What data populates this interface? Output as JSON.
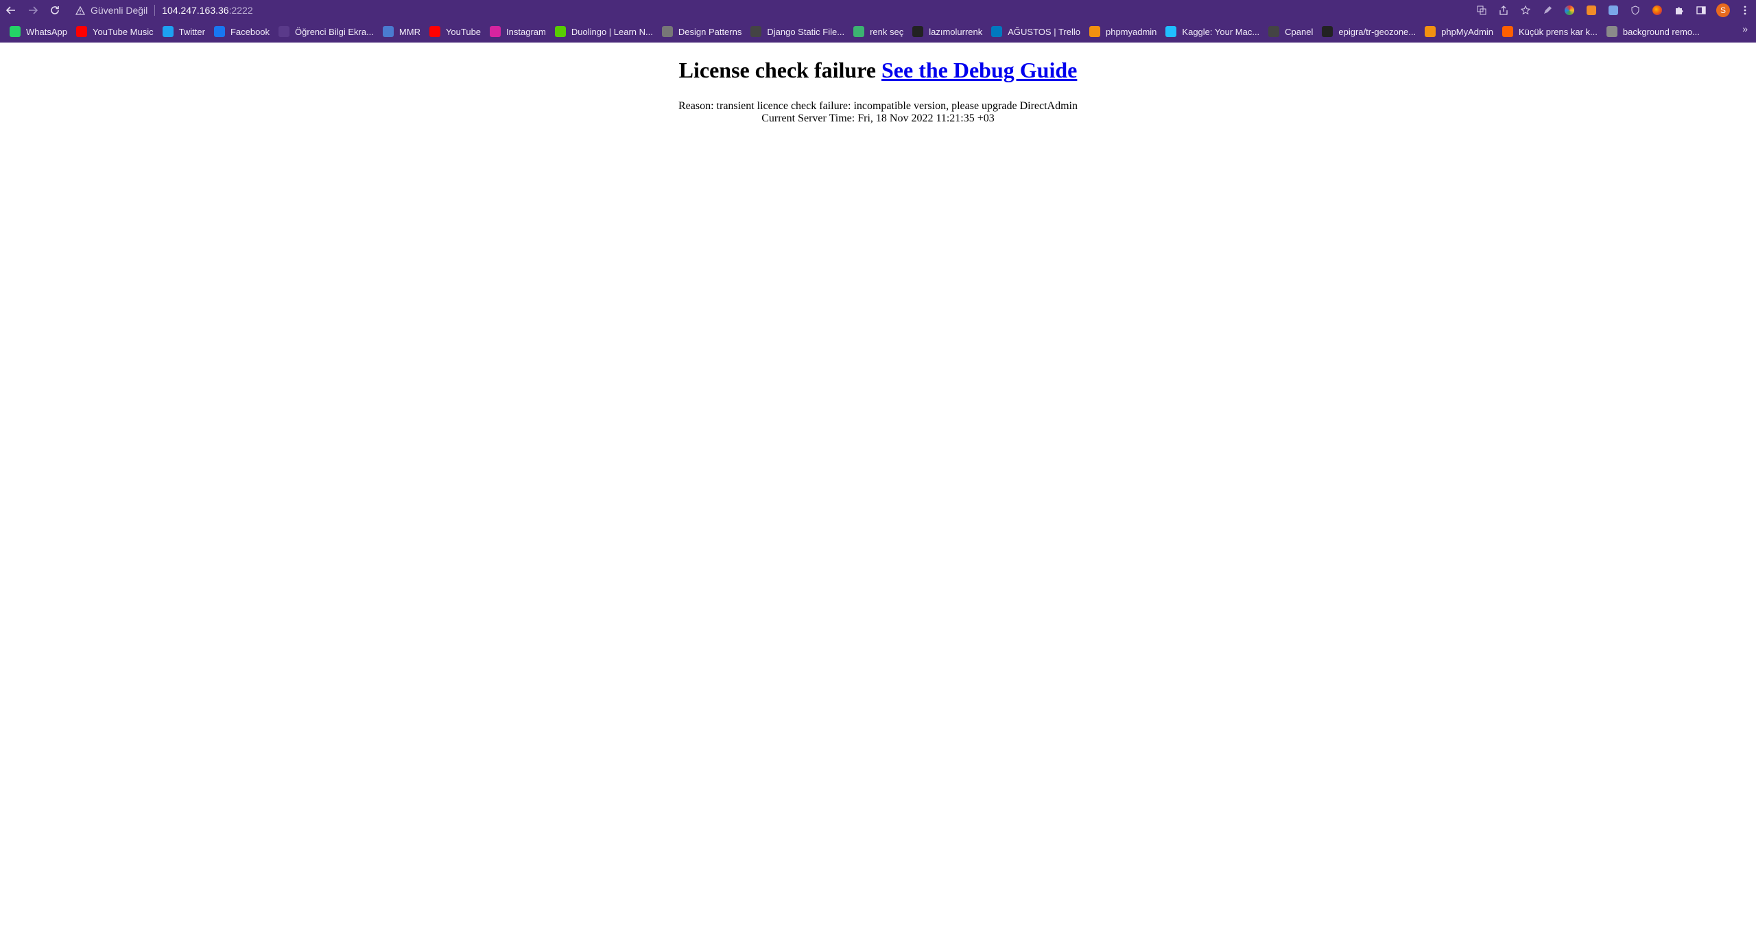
{
  "browser": {
    "security_label": "Güvenli Değil",
    "url_host": "104.247.163.36",
    "url_port": ":2222",
    "profile_initial": "S"
  },
  "bookmarks": [
    {
      "label": "WhatsApp",
      "icon": "whatsapp-icon",
      "color": "#25d366"
    },
    {
      "label": "YouTube Music",
      "icon": "youtube-music-icon",
      "color": "#ff0000"
    },
    {
      "label": "Twitter",
      "icon": "twitter-icon",
      "color": "#1da1f2"
    },
    {
      "label": "Facebook",
      "icon": "facebook-icon",
      "color": "#1877f2"
    },
    {
      "label": "Öğrenci Bilgi Ekra...",
      "icon": "page-icon",
      "color": "#5a3a8a"
    },
    {
      "label": "MMR",
      "icon": "mmr-icon",
      "color": "#4a7bd0"
    },
    {
      "label": "YouTube",
      "icon": "youtube-icon",
      "color": "#ff0000"
    },
    {
      "label": "Instagram",
      "icon": "instagram-icon",
      "color": "#d6249f"
    },
    {
      "label": "Duolingo | Learn N...",
      "icon": "duolingo-icon",
      "color": "#58cc02"
    },
    {
      "label": "Design Patterns",
      "icon": "design-patterns-icon",
      "color": "#777777"
    },
    {
      "label": "Django Static File...",
      "icon": "globe-icon",
      "color": "#444444"
    },
    {
      "label": "renk seç",
      "icon": "color-palette-icon",
      "color": "#3cb371"
    },
    {
      "label": "lazımolurrenk",
      "icon": "dribbble-icon",
      "color": "#222222"
    },
    {
      "label": "AĞUSTOS | Trello",
      "icon": "trello-icon",
      "color": "#0079bf"
    },
    {
      "label": "phpmyadmin",
      "icon": "phpmyadmin-icon",
      "color": "#f29111"
    },
    {
      "label": "Kaggle: Your Mac...",
      "icon": "kaggle-icon",
      "color": "#20beff"
    },
    {
      "label": "Cpanel",
      "icon": "globe-icon",
      "color": "#444444"
    },
    {
      "label": "epigra/tr-geozone...",
      "icon": "github-icon",
      "color": "#222222"
    },
    {
      "label": "phpMyAdmin",
      "icon": "phpmyadmin-icon",
      "color": "#f29111"
    },
    {
      "label": "Küçük prens kar k...",
      "icon": "hepsiburada-icon",
      "color": "#ff6000"
    },
    {
      "label": "background remo...",
      "icon": "remove-bg-icon",
      "color": "#8a8a8a"
    }
  ],
  "page": {
    "heading_text": "License check failure",
    "heading_link": "See the Debug Guide",
    "reason": "Reason: transient licence check failure: incompatible version, please upgrade DirectAdmin",
    "server_time": "Current Server Time: Fri, 18 Nov 2022 11:21:35 +03"
  }
}
